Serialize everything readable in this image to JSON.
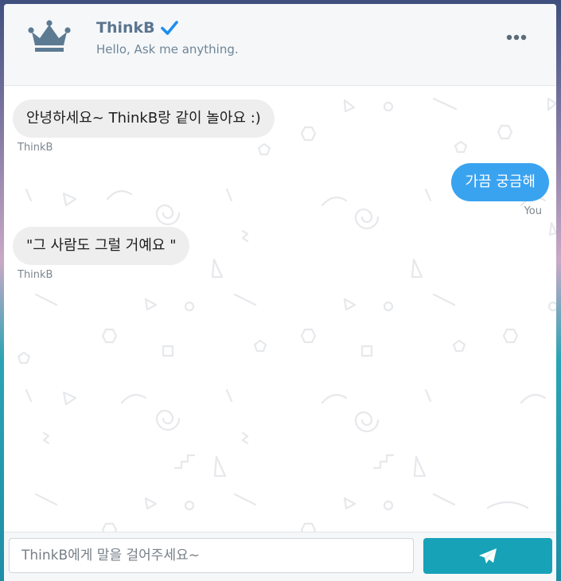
{
  "header": {
    "title": "ThinkB",
    "subtitle": "Hello, Ask me anything.",
    "avatar_icon": "crown-icon",
    "verified_icon": "check-icon",
    "menu_icon": "more-horizontal-icon"
  },
  "messages": [
    {
      "from": "bot",
      "text": "안녕하세요~ ThinkB랑 같이 놀아요 :)",
      "sender": "ThinkB"
    },
    {
      "from": "user",
      "text": "가끔 궁금해",
      "sender": "You"
    },
    {
      "from": "bot",
      "text": "\"그 사람도 그럴 거예요 \"",
      "sender": "ThinkB"
    }
  ],
  "composer": {
    "placeholder": "ThinkB에게 말을 걸어주세요~",
    "value": "",
    "send_icon": "paper-plane-icon"
  },
  "colors": {
    "user_bubble": "#3aa3f0",
    "bot_bubble": "#eeeeee",
    "send_button": "#17a2b8",
    "title": "#5b7590",
    "verified": "#1d8df0"
  }
}
